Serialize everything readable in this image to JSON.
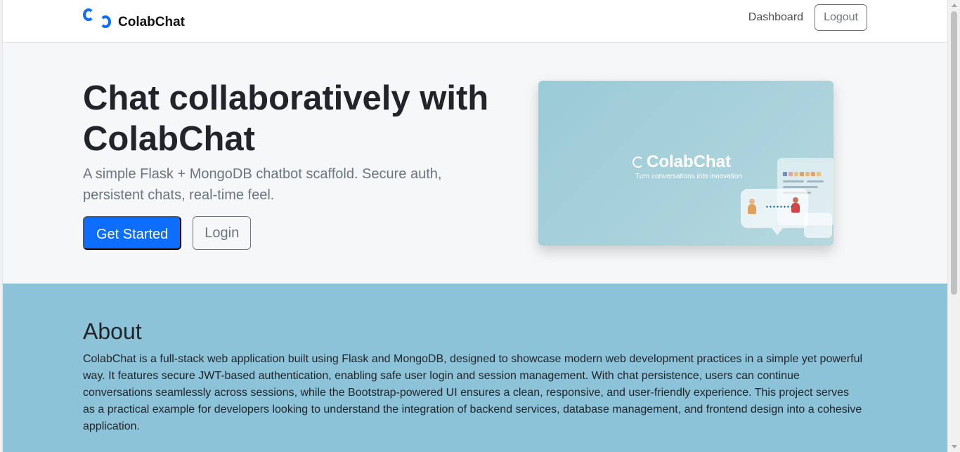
{
  "navbar": {
    "brand": "ColabChat",
    "links": [
      {
        "label": "Dashboard"
      }
    ],
    "logout_label": "Logout"
  },
  "hero": {
    "title": "Chat collaboratively with ColabChat",
    "subtitle": "A simple Flask + MongoDB chatbot scaffold. Secure auth, persistent chats, real-time feel.",
    "primary_button": "Get Started",
    "secondary_button": "Login",
    "image": {
      "logo_text": "ColabChat",
      "tagline": "Turn conversations into innovation"
    }
  },
  "about": {
    "title": "About",
    "text": "ColabChat is a full-stack web application built using Flask and MongoDB, designed to showcase modern web development practices in a simple yet powerful way. It features secure JWT-based authentication, enabling safe user login and session management. With chat persistence, users can continue conversations seamlessly across sessions, while the Bootstrap-powered UI ensures a clean, responsive, and user-friendly experience. This project serves as a practical example for developers looking to understand the integration of backend services, database management, and frontend design into a cohesive application."
  },
  "colors": {
    "primary": "#0d6efd",
    "hero_bg": "#f6f7f9",
    "about_bg": "#8dc3d8",
    "text": "#212529",
    "muted": "#6c757d"
  },
  "icons": {
    "brand_logo": "colabchat-logo-icon"
  }
}
